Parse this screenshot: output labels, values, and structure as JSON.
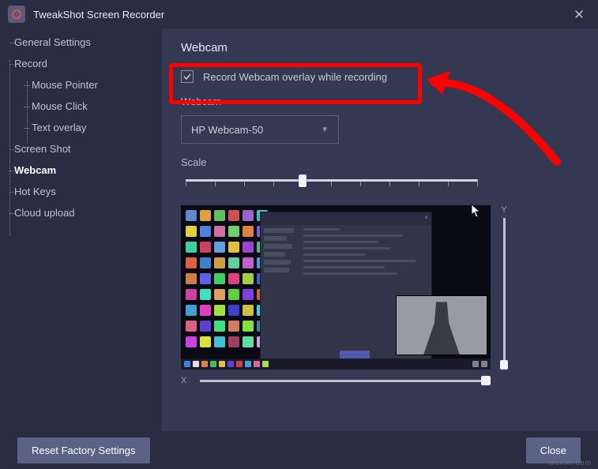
{
  "app": {
    "title": "TweakShot Screen Recorder"
  },
  "sidebar": {
    "items": [
      {
        "label": "General Settings"
      },
      {
        "label": "Record",
        "children": [
          {
            "label": "Mouse Pointer"
          },
          {
            "label": "Mouse Click"
          },
          {
            "label": "Text overlay"
          }
        ]
      },
      {
        "label": "Screen Shot"
      },
      {
        "label": "Webcam"
      },
      {
        "label": "Hot Keys"
      },
      {
        "label": "Cloud upload"
      }
    ]
  },
  "page": {
    "title": "Webcam",
    "checkbox_label": "Record Webcam overlay while recording",
    "checkbox_checked": true,
    "webcam_label": "Webcam",
    "webcam_selected": "HP Webcam-50",
    "scale_label": "Scale",
    "scale_value": 40,
    "axis_x_label": "X",
    "axis_y_label": "Y",
    "axis_x_value": 95,
    "axis_y_value": 95
  },
  "footer": {
    "reset_label": "Reset Factory Settings",
    "close_label": "Close"
  },
  "watermark": "wsxdn.com"
}
